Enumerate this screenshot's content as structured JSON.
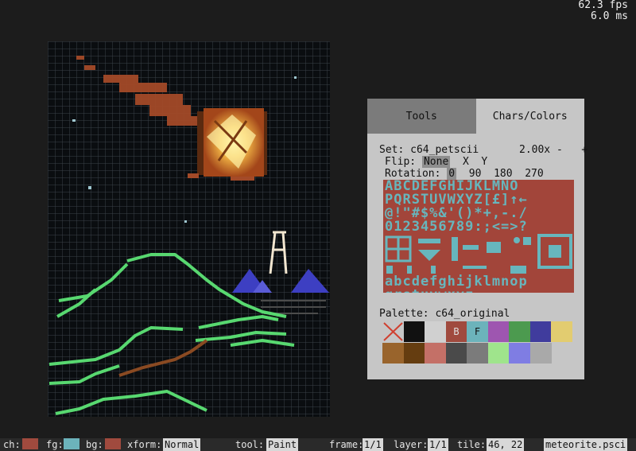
{
  "perf": {
    "fps": "62.3 fps",
    "ms": "6.0 ms"
  },
  "panel": {
    "tabs": [
      {
        "label": "Tools"
      },
      {
        "label": "Chars/Colors"
      }
    ],
    "set_label": "Set:",
    "set_name": "c64_petscii",
    "zoom": "2.00x",
    "zoom_minus": "-",
    "zoom_plus": "+",
    "flip_label": "Flip:",
    "flip_options": [
      "None",
      "X",
      "Y"
    ],
    "rotation_label": "Rotation:",
    "rotation_options": [
      "0",
      "90",
      "180",
      "270"
    ],
    "charset_lines": [
      "ABCDEFGHIJKLMNO",
      "PQRSTUVWXYZ[£]↑←",
      "@!\"#$%&'()*+,-./",
      "0123456789:;<=>?",
      "",
      "",
      "abcdefghijklmnop",
      "qrstuvwxyz"
    ],
    "palette_label": "Palette:",
    "palette_name": "c64_original",
    "palette": [
      "#000000",
      "#111111",
      "#d0d0d0",
      "#a04a3e",
      "#6cb3bb",
      "#9e56b0",
      "#4c9a4f",
      "#403c9d",
      "#e2cc70",
      "#99642c",
      "#653d10",
      "#c47067",
      "#4a4a4a",
      "#7b7b7b",
      "#9fe48c",
      "#7f7de3",
      "#a9a9a9"
    ],
    "palette_bg_marker": "B",
    "palette_fg_marker": "F"
  },
  "status": {
    "ch_label": "ch:",
    "fg_label": "fg:",
    "bg_label": "bg:",
    "xform_label": "xform:",
    "xform_value": "Normal",
    "tool_label": "tool:",
    "tool_value": "Paint",
    "frame_label": "frame:",
    "frame_value": "1/1",
    "layer_label": "layer:",
    "layer_value": "1/1",
    "tile_label": "tile:",
    "tile_value": "46, 22",
    "filename": "meteorite.psci",
    "fg_color": "#6cb3bb",
    "bg_color": "#a04a3e"
  }
}
